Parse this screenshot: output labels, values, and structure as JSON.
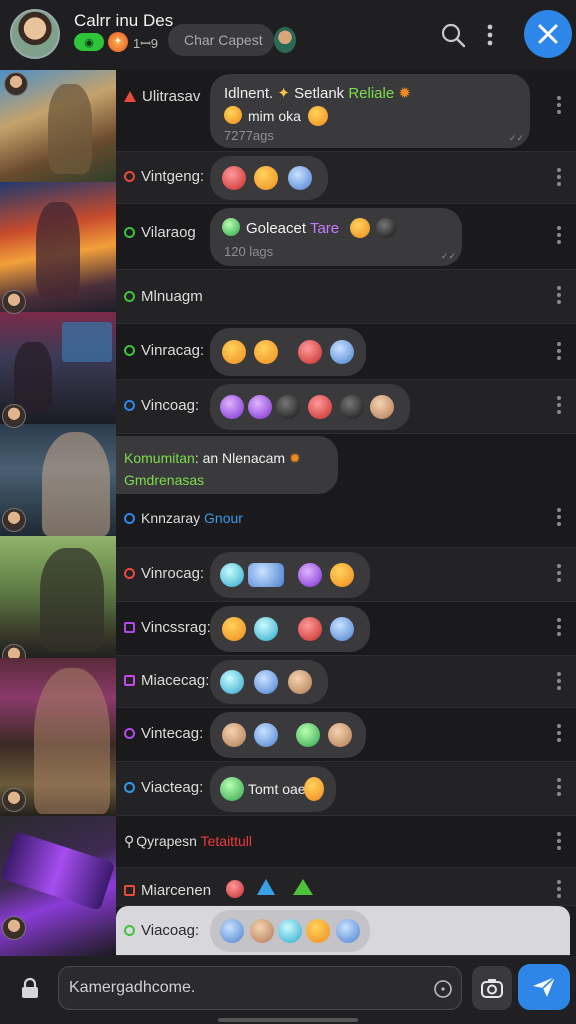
{
  "header": {
    "title": "Calrr inu Des",
    "badge_green": "◉",
    "count": "1ꟷ9",
    "pill_label": "Char Capest",
    "colors": {
      "accent": "#2e86e8",
      "background": "#1c1c1e"
    }
  },
  "strip": {
    "images": [
      "soldier-art",
      "warrior-art",
      "gamer-desk-art",
      "headset-player-art",
      "rifle-soldier-art",
      "headset-gamer-art",
      "keyboard-art"
    ]
  },
  "rows": [
    {
      "label": "Ulitrasav",
      "marker_color": "#e84a3b",
      "marker": "tri",
      "bubble_line1": "Idlnent. ",
      "bubble_line1_b": "Setlank ",
      "bubble_line1_c": "Reliale",
      "bubble_line2": "mim oka",
      "bubble_sub": "7277ags"
    },
    {
      "label": "Vintgeng:",
      "marker_color": "#e84a3b",
      "marker": "circle"
    },
    {
      "label": "Vilaraog",
      "marker_color": "#3ec23e",
      "marker": "circle",
      "bubble_line1": "Goleacet ",
      "bubble_line1_b": "Tare",
      "bubble_sub": "120 lags"
    },
    {
      "label": "Mlnuagm",
      "marker_color": "#3ec23e",
      "marker": "circle"
    },
    {
      "label": "Vinracag:",
      "marker_color": "#3ec23e",
      "marker": "circle"
    },
    {
      "label": "Vincoag:",
      "marker_color": "#2e86e8",
      "marker": "circle"
    },
    {
      "label_a": "Komumitan",
      "label_b": ": an Nlenacam",
      "label_c": "Gmdrenasas",
      "label_d": "Knnzaray ",
      "label_e": "Gnour",
      "marker_color": "#2e86e8",
      "marker": "circle"
    },
    {
      "label": "Vinrocag:",
      "marker_color": "#e84a3b",
      "marker": "circle"
    },
    {
      "label": "Vincssrag:",
      "marker_color": "#b04ae8",
      "marker": "square"
    },
    {
      "label": "Miacecag:",
      "marker_color": "#c54ae8",
      "marker": "square"
    },
    {
      "label": "Vintecag:",
      "marker_color": "#b04ae8",
      "marker": "circle"
    },
    {
      "label": "Viacteag:",
      "marker_color": "#2e9be8",
      "marker": "circle",
      "tail_text": "Tomt oae"
    },
    {
      "label_a": "Qyrapesn ",
      "label_b": "Tetaittull",
      "marker": "search"
    },
    {
      "label": "Miarcenen",
      "marker_color": "#e84a3b",
      "marker": "square"
    },
    {
      "label": "Viacoag:",
      "marker_color": "#3ec23e",
      "marker": "circle"
    }
  ],
  "composer": {
    "placeholder": "Kamergadhcome."
  }
}
